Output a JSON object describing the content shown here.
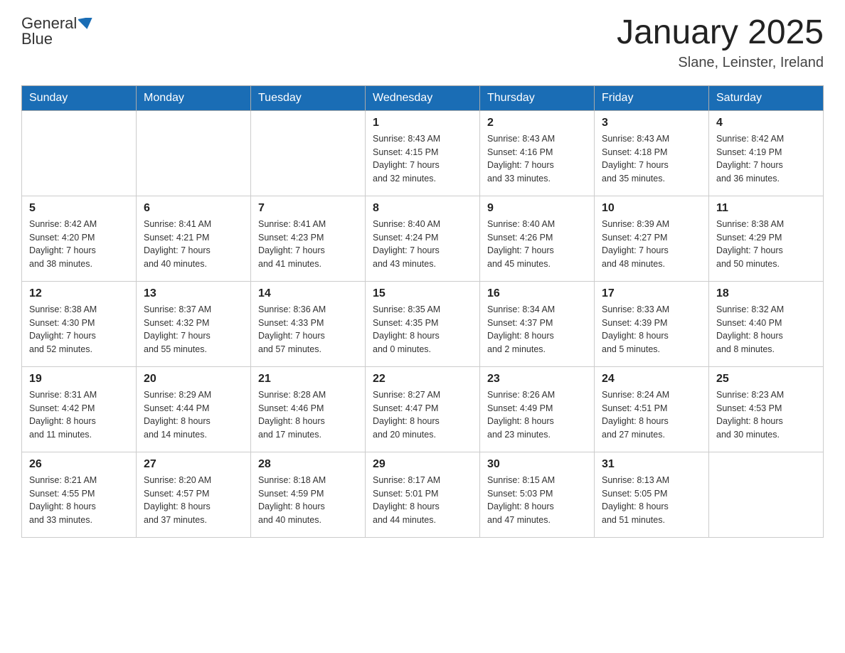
{
  "header": {
    "logo_general": "General",
    "logo_blue": "Blue",
    "month_title": "January 2025",
    "location": "Slane, Leinster, Ireland"
  },
  "days_of_week": [
    "Sunday",
    "Monday",
    "Tuesday",
    "Wednesday",
    "Thursday",
    "Friday",
    "Saturday"
  ],
  "weeks": [
    [
      {
        "day": "",
        "info": ""
      },
      {
        "day": "",
        "info": ""
      },
      {
        "day": "",
        "info": ""
      },
      {
        "day": "1",
        "info": "Sunrise: 8:43 AM\nSunset: 4:15 PM\nDaylight: 7 hours\nand 32 minutes."
      },
      {
        "day": "2",
        "info": "Sunrise: 8:43 AM\nSunset: 4:16 PM\nDaylight: 7 hours\nand 33 minutes."
      },
      {
        "day": "3",
        "info": "Sunrise: 8:43 AM\nSunset: 4:18 PM\nDaylight: 7 hours\nand 35 minutes."
      },
      {
        "day": "4",
        "info": "Sunrise: 8:42 AM\nSunset: 4:19 PM\nDaylight: 7 hours\nand 36 minutes."
      }
    ],
    [
      {
        "day": "5",
        "info": "Sunrise: 8:42 AM\nSunset: 4:20 PM\nDaylight: 7 hours\nand 38 minutes."
      },
      {
        "day": "6",
        "info": "Sunrise: 8:41 AM\nSunset: 4:21 PM\nDaylight: 7 hours\nand 40 minutes."
      },
      {
        "day": "7",
        "info": "Sunrise: 8:41 AM\nSunset: 4:23 PM\nDaylight: 7 hours\nand 41 minutes."
      },
      {
        "day": "8",
        "info": "Sunrise: 8:40 AM\nSunset: 4:24 PM\nDaylight: 7 hours\nand 43 minutes."
      },
      {
        "day": "9",
        "info": "Sunrise: 8:40 AM\nSunset: 4:26 PM\nDaylight: 7 hours\nand 45 minutes."
      },
      {
        "day": "10",
        "info": "Sunrise: 8:39 AM\nSunset: 4:27 PM\nDaylight: 7 hours\nand 48 minutes."
      },
      {
        "day": "11",
        "info": "Sunrise: 8:38 AM\nSunset: 4:29 PM\nDaylight: 7 hours\nand 50 minutes."
      }
    ],
    [
      {
        "day": "12",
        "info": "Sunrise: 8:38 AM\nSunset: 4:30 PM\nDaylight: 7 hours\nand 52 minutes."
      },
      {
        "day": "13",
        "info": "Sunrise: 8:37 AM\nSunset: 4:32 PM\nDaylight: 7 hours\nand 55 minutes."
      },
      {
        "day": "14",
        "info": "Sunrise: 8:36 AM\nSunset: 4:33 PM\nDaylight: 7 hours\nand 57 minutes."
      },
      {
        "day": "15",
        "info": "Sunrise: 8:35 AM\nSunset: 4:35 PM\nDaylight: 8 hours\nand 0 minutes."
      },
      {
        "day": "16",
        "info": "Sunrise: 8:34 AM\nSunset: 4:37 PM\nDaylight: 8 hours\nand 2 minutes."
      },
      {
        "day": "17",
        "info": "Sunrise: 8:33 AM\nSunset: 4:39 PM\nDaylight: 8 hours\nand 5 minutes."
      },
      {
        "day": "18",
        "info": "Sunrise: 8:32 AM\nSunset: 4:40 PM\nDaylight: 8 hours\nand 8 minutes."
      }
    ],
    [
      {
        "day": "19",
        "info": "Sunrise: 8:31 AM\nSunset: 4:42 PM\nDaylight: 8 hours\nand 11 minutes."
      },
      {
        "day": "20",
        "info": "Sunrise: 8:29 AM\nSunset: 4:44 PM\nDaylight: 8 hours\nand 14 minutes."
      },
      {
        "day": "21",
        "info": "Sunrise: 8:28 AM\nSunset: 4:46 PM\nDaylight: 8 hours\nand 17 minutes."
      },
      {
        "day": "22",
        "info": "Sunrise: 8:27 AM\nSunset: 4:47 PM\nDaylight: 8 hours\nand 20 minutes."
      },
      {
        "day": "23",
        "info": "Sunrise: 8:26 AM\nSunset: 4:49 PM\nDaylight: 8 hours\nand 23 minutes."
      },
      {
        "day": "24",
        "info": "Sunrise: 8:24 AM\nSunset: 4:51 PM\nDaylight: 8 hours\nand 27 minutes."
      },
      {
        "day": "25",
        "info": "Sunrise: 8:23 AM\nSunset: 4:53 PM\nDaylight: 8 hours\nand 30 minutes."
      }
    ],
    [
      {
        "day": "26",
        "info": "Sunrise: 8:21 AM\nSunset: 4:55 PM\nDaylight: 8 hours\nand 33 minutes."
      },
      {
        "day": "27",
        "info": "Sunrise: 8:20 AM\nSunset: 4:57 PM\nDaylight: 8 hours\nand 37 minutes."
      },
      {
        "day": "28",
        "info": "Sunrise: 8:18 AM\nSunset: 4:59 PM\nDaylight: 8 hours\nand 40 minutes."
      },
      {
        "day": "29",
        "info": "Sunrise: 8:17 AM\nSunset: 5:01 PM\nDaylight: 8 hours\nand 44 minutes."
      },
      {
        "day": "30",
        "info": "Sunrise: 8:15 AM\nSunset: 5:03 PM\nDaylight: 8 hours\nand 47 minutes."
      },
      {
        "day": "31",
        "info": "Sunrise: 8:13 AM\nSunset: 5:05 PM\nDaylight: 8 hours\nand 51 minutes."
      },
      {
        "day": "",
        "info": ""
      }
    ]
  ]
}
